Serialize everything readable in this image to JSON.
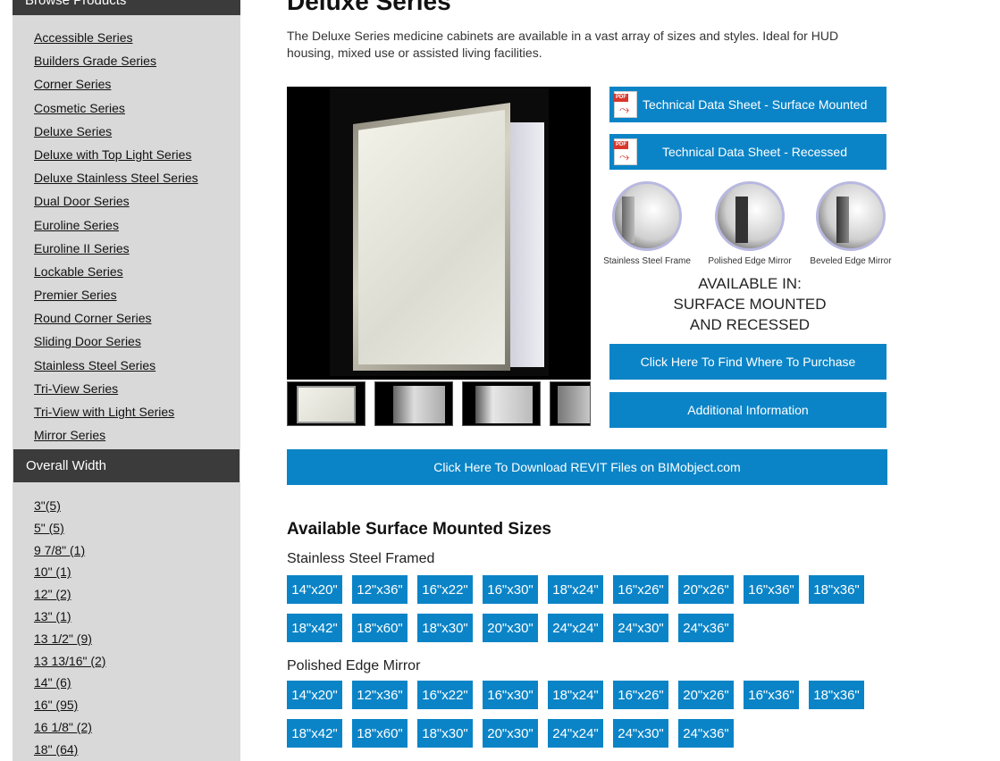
{
  "sidebar": {
    "browse_header": "Browse Products",
    "series": [
      "Accessible Series",
      "Builders Grade Series",
      "Corner Series",
      "Cosmetic Series",
      "Deluxe Series",
      "Deluxe with Top Light Series",
      "Deluxe Stainless Steel Series",
      "Dual Door Series",
      "Euroline Series",
      "Euroline II Series",
      "Lockable Series",
      "Premier Series",
      "Round Corner Series",
      "Sliding Door Series",
      "Stainless Steel Series",
      "Tri-View Series",
      "Tri-View with Light Series",
      "Mirror Series"
    ],
    "width_header": "Overall Width",
    "widths": [
      "3\"(5)",
      "5\" (5)",
      "9 7/8\" (1)",
      "10\" (1)",
      "12\" (2)",
      "13\" (1)",
      "13 1/2\" (9)",
      "13 13/16\" (2)",
      "14\" (6)",
      "16\" (95)",
      "16 1/8\" (2)",
      "18\" (64)"
    ]
  },
  "main": {
    "title": "Deluxe Series",
    "intro": "The Deluxe Series medicine cabinets are available in a vast array of sizes and styles. Ideal for HUD housing, mixed use or assisted living facilities.",
    "pdf_tag": "PDF",
    "pdf_surface": "Technical Data Sheet - Surface Mounted",
    "pdf_recessed": "Technical Data Sheet - Recessed",
    "finishes": [
      "Stainless Steel Frame",
      "Polished Edge Mirror",
      "Beveled Edge Mirror"
    ],
    "available_lines": [
      "AVAILABLE IN:",
      "SURFACE MOUNTED",
      "AND RECESSED"
    ],
    "purchase_button": "Click Here To Find Where To Purchase",
    "info_button": "Additional Information",
    "revit_button": "Click Here To Download REVIT Files on BIMobject.com",
    "sizes_title": "Available Surface Mounted Sizes",
    "groups": [
      {
        "name": "Stainless Steel Framed",
        "sizes": [
          "14\"x20\"",
          "12\"x36\"",
          "16\"x22\"",
          "16\"x30\"",
          "18\"x24\"",
          "16\"x26\"",
          "20\"x26\"",
          "16\"x36\"",
          "18\"x36\"",
          "18\"x42\"",
          "18\"x60\"",
          "18\"x30\"",
          "20\"x30\"",
          "24\"x24\"",
          "24\"x30\"",
          "24\"x36\""
        ]
      },
      {
        "name": "Polished Edge Mirror",
        "sizes": [
          "14\"x20\"",
          "12\"x36\"",
          "16\"x22\"",
          "16\"x30\"",
          "18\"x24\"",
          "16\"x26\"",
          "20\"x26\"",
          "16\"x36\"",
          "18\"x36\"",
          "18\"x42\"",
          "18\"x60\"",
          "18\"x30\"",
          "20\"x30\"",
          "24\"x24\"",
          "24\"x30\"",
          "24\"x36\""
        ]
      }
    ]
  }
}
